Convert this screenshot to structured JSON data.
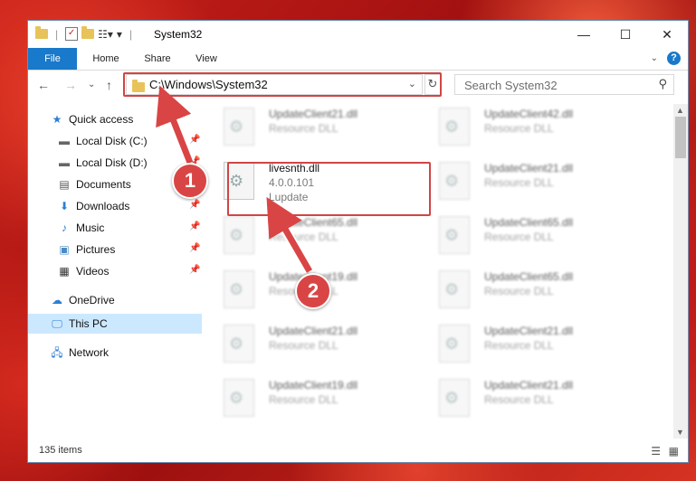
{
  "window": {
    "title": "System32",
    "controls": {
      "minimize": "—",
      "maximize": "☐",
      "close": "✕"
    }
  },
  "ribbon": {
    "tabs": [
      "File",
      "Home",
      "Share",
      "View"
    ]
  },
  "address": {
    "path": "C:\\Windows\\System32",
    "search_placeholder": "Search System32"
  },
  "sidebar": {
    "items": [
      {
        "label": "Quick access",
        "icon": "star-icon",
        "pinned": false
      },
      {
        "label": "Local Disk (C:)",
        "icon": "drive-icon",
        "pinned": true
      },
      {
        "label": "Local Disk (D:)",
        "icon": "drive-icon",
        "pinned": true
      },
      {
        "label": "Documents",
        "icon": "document-icon",
        "pinned": true
      },
      {
        "label": "Downloads",
        "icon": "download-icon",
        "pinned": true
      },
      {
        "label": "Music",
        "icon": "music-icon",
        "pinned": true
      },
      {
        "label": "Pictures",
        "icon": "pictures-icon",
        "pinned": true
      },
      {
        "label": "Videos",
        "icon": "video-icon",
        "pinned": true
      },
      {
        "label": "OneDrive",
        "icon": "cloud-icon",
        "pinned": false
      },
      {
        "label": "This PC",
        "icon": "computer-icon",
        "pinned": false,
        "selected": true
      },
      {
        "label": "Network",
        "icon": "network-icon",
        "pinned": false
      }
    ]
  },
  "files": {
    "left_column": [
      {
        "name": "UpdateClient21.dll",
        "sub": "Resource DLL"
      },
      {
        "name": "livesnth.dll",
        "sub": "4.0.0.101",
        "sub2": "Lupdate"
      },
      {
        "name": "UpdateClient65.dll",
        "sub": "Resource DLL"
      },
      {
        "name": "UpdateClient19.dll",
        "sub": "Resource DLL"
      },
      {
        "name": "UpdateClient21.dll",
        "sub": "Resource DLL"
      },
      {
        "name": "UpdateClient19.dll",
        "sub": "Resource DLL"
      }
    ],
    "right_column": [
      {
        "name": "UpdateClient42.dll",
        "sub": "Resource DLL"
      },
      {
        "name": "UpdateClient21.dll",
        "sub": "Resource DLL"
      },
      {
        "name": "UpdateClient65.dll",
        "sub": "Resource DLL"
      },
      {
        "name": "UpdateClient65.dll",
        "sub": "Resource DLL"
      },
      {
        "name": "UpdateClient21.dll",
        "sub": "Resource DLL"
      },
      {
        "name": "UpdateClient21.dll",
        "sub": "Resource DLL"
      }
    ]
  },
  "status": {
    "items_count": "135 items"
  },
  "annotations": {
    "step1": "1",
    "step2": "2",
    "color": "#d94545"
  }
}
